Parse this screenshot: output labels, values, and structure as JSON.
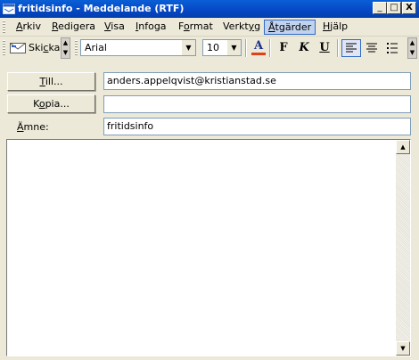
{
  "window": {
    "title": "fritidsinfo - Meddelande (RTF)",
    "controls": {
      "minimize": "_",
      "maximize": "□",
      "close": "X"
    }
  },
  "menubar": {
    "items": [
      {
        "pre": "",
        "key": "A",
        "post": "rkiv"
      },
      {
        "pre": "",
        "key": "R",
        "post": "edigera"
      },
      {
        "pre": "",
        "key": "V",
        "post": "isa"
      },
      {
        "pre": "",
        "key": "I",
        "post": "nfoga"
      },
      {
        "pre": "F",
        "key": "o",
        "post": "rmat"
      },
      {
        "pre": "Verkt",
        "key": "y",
        "post": "g"
      },
      {
        "pre": "",
        "key": "Å",
        "post": "tgärder"
      },
      {
        "pre": "",
        "key": "H",
        "post": "jälp"
      }
    ]
  },
  "toolbar": {
    "send": {
      "pre": "Ski",
      "key": "c",
      "post": "ka"
    },
    "font_family": "Arial",
    "font_size": "10",
    "text_color_glyph": "A",
    "bold": "F",
    "italic": "K",
    "underline": "U",
    "colors": {
      "text_color_bar": "#e0401a"
    }
  },
  "header": {
    "to": {
      "label_key": "T",
      "label_post": "ill...",
      "value": "anders.appelqvist@kristianstad.se"
    },
    "cc": {
      "label_pre": "K",
      "label_key": "o",
      "label_post": "pia...",
      "value": ""
    },
    "subject": {
      "label_key": "Ä",
      "label_post": "mne:",
      "value": "fritidsinfo"
    }
  },
  "body": {
    "text": ""
  },
  "icons": [
    "outlook-window-icon",
    "send-envelope-icon",
    "align-left-icon",
    "align-center-icon",
    "bullets-icon",
    "chevron-down-icon",
    "scroll-up-icon",
    "scroll-down-icon"
  ]
}
